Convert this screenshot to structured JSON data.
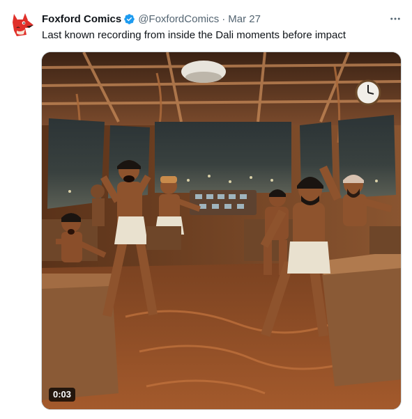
{
  "tweet": {
    "author_name": "Foxford Comics",
    "handle": "@FoxfordComics",
    "separator": "·",
    "date": "Mar 27",
    "text": "Last known recording from inside the Dali moments before impact",
    "avatar_icon": "fox-logo-icon",
    "verified_icon": "verified-badge-icon",
    "more_icon": "more-options-icon"
  },
  "media": {
    "type": "video",
    "duration": "0:03"
  },
  "colors": {
    "verified_blue": "#1d9bf0",
    "secondary_text": "#536471",
    "primary_text": "#0f1419",
    "fox_red": "#e0302a"
  }
}
